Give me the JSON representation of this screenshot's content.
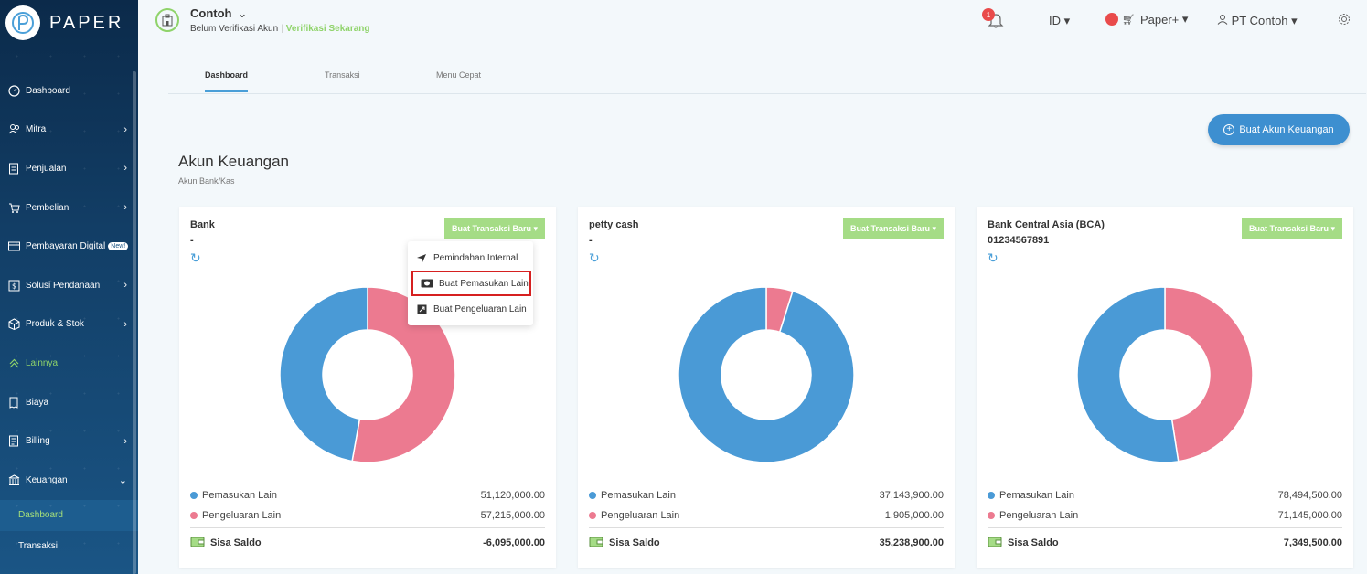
{
  "brand": {
    "name": "PAPER"
  },
  "sidebar": {
    "items": [
      {
        "label": "Dashboard",
        "icon": "dashboard-icon",
        "chevron": ""
      },
      {
        "label": "Mitra",
        "icon": "users-icon",
        "chevron": "›"
      },
      {
        "label": "Penjualan",
        "icon": "document-icon",
        "chevron": "›"
      },
      {
        "label": "Pembelian",
        "icon": "cart-icon",
        "chevron": "›"
      },
      {
        "label": "Pembayaran Digital",
        "icon": "card-icon",
        "chevron": "",
        "badge": "New!"
      },
      {
        "label": "Solusi Pendanaan",
        "icon": "funding-icon",
        "chevron": "›"
      },
      {
        "label": "Produk & Stok",
        "icon": "box-icon",
        "chevron": "›"
      },
      {
        "label": "Lainnya",
        "icon": "chevrons-up-icon",
        "chevron": ""
      },
      {
        "label": "Biaya",
        "icon": "receipt-icon",
        "chevron": ""
      },
      {
        "label": "Billing",
        "icon": "billing-icon",
        "chevron": "›"
      },
      {
        "label": "Keuangan",
        "icon": "bank-icon",
        "chevron": "⌄"
      }
    ],
    "sub_items": [
      {
        "label": "Dashboard"
      },
      {
        "label": "Transaksi"
      }
    ]
  },
  "header": {
    "company": "Contoh",
    "verify_status": "Belum Verifikasi Akun",
    "verify_link": "Verifikasi Sekarang",
    "notif_count": "1",
    "language": "ID",
    "plan": "Paper+",
    "user": "PT Contoh"
  },
  "tabs": [
    {
      "label": "Dashboard"
    },
    {
      "label": "Transaksi"
    },
    {
      "label": "Menu Cepat"
    }
  ],
  "create_account_button": "Buat Akun Keuangan",
  "section": {
    "title": "Akun Keuangan",
    "subtitle": "Akun Bank/Kas"
  },
  "new_transaction_label": "Buat Transaksi Baru",
  "legend_labels": {
    "income": "Pemasukan Lain",
    "expense": "Pengeluaran Lain",
    "balance": "Sisa Saldo"
  },
  "colors": {
    "income": "#4a9ad6",
    "expense": "#ec7a90",
    "accent_green": "#a5dc86",
    "primary": "#3d8fd0"
  },
  "dropdown": {
    "items": [
      {
        "label": "Pemindahan Internal",
        "icon": "send-icon"
      },
      {
        "label": "Buat Pemasukan Lain",
        "icon": "cash-icon"
      },
      {
        "label": "Buat Pengeluaran Lain",
        "icon": "expense-icon"
      }
    ]
  },
  "accounts": [
    {
      "name": "Bank",
      "number": "-",
      "income": "51,120,000.00",
      "expense": "57,215,000.00",
      "balance": "-6,095,000.00",
      "income_value": 51120000,
      "expense_value": 57215000
    },
    {
      "name": "petty cash",
      "number": "-",
      "income": "37,143,900.00",
      "expense": "1,905,000.00",
      "balance": "35,238,900.00",
      "income_value": 37143900,
      "expense_value": 1905000
    },
    {
      "name": "Bank Central Asia (BCA)",
      "number": "01234567891",
      "income": "78,494,500.00",
      "expense": "71,145,000.00",
      "balance": "7,349,500.00",
      "income_value": 78494500,
      "expense_value": 71145000
    }
  ]
}
